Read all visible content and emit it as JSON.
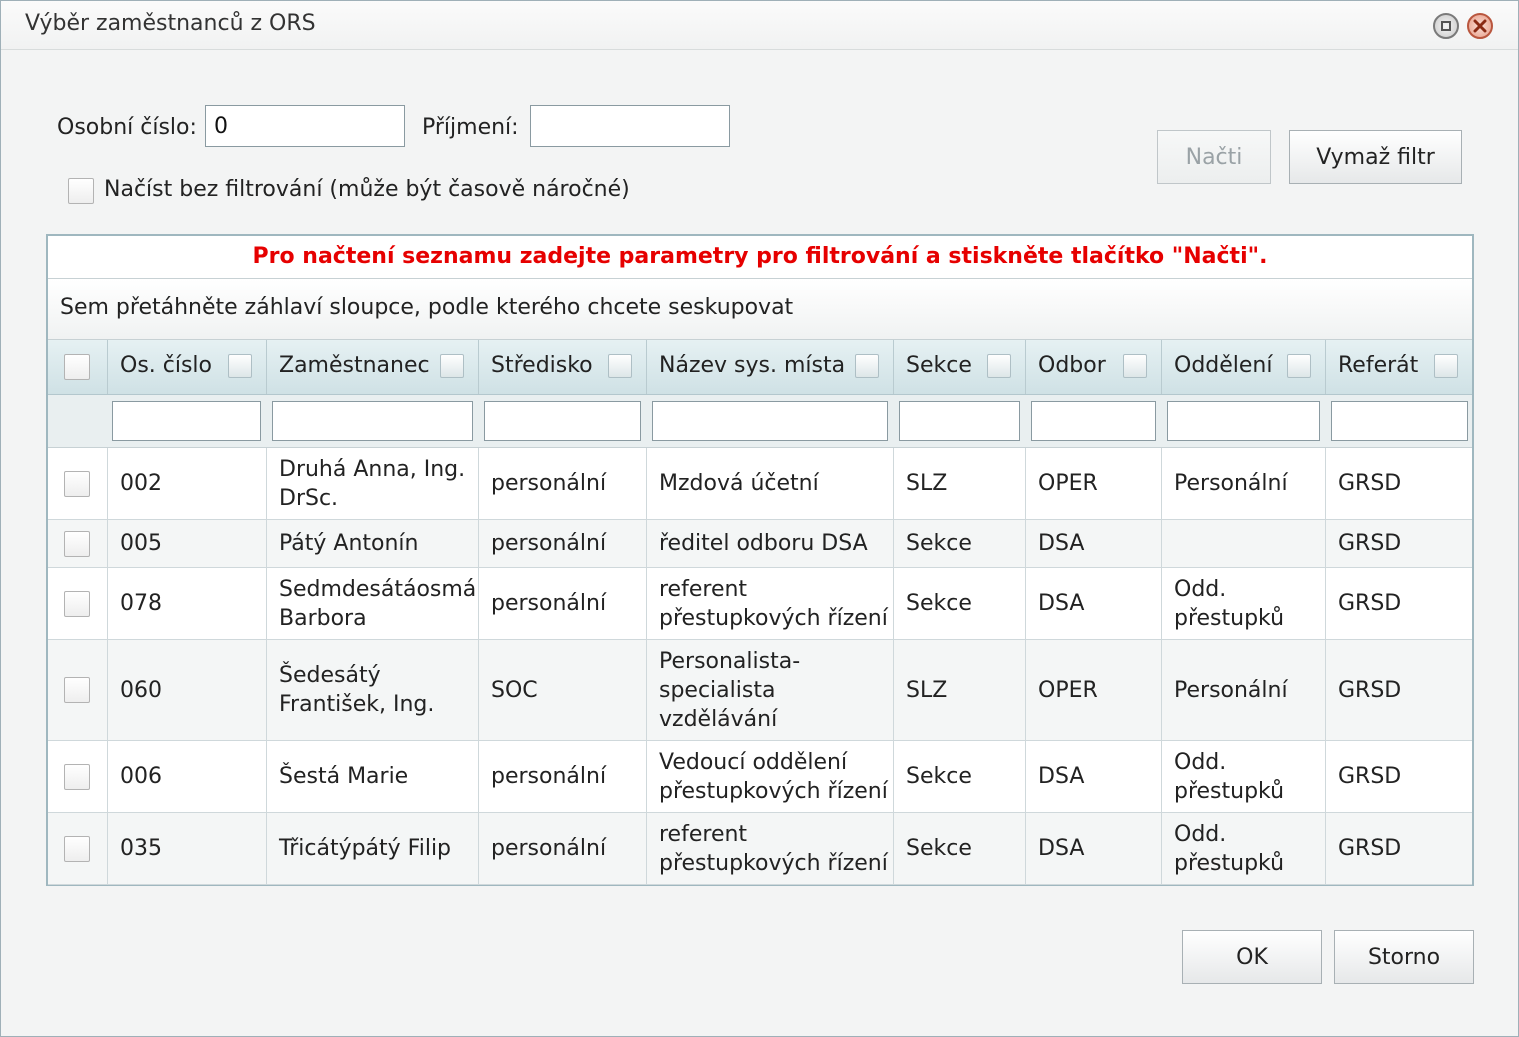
{
  "window": {
    "title": "Výběr zaměstnanců z ORS"
  },
  "filters": {
    "personal_number_label": "Osobní číslo:",
    "personal_number_value": "0",
    "surname_label": "Příjmení:",
    "surname_value": "",
    "no_filter_label": "Načíst bez filtrování (může být časově náročné)",
    "load_button": "Načti",
    "clear_button": "Vymaž filtr"
  },
  "grid": {
    "message": "Pro načtení seznamu zadejte parametry pro filtrování a stiskněte tlačítko \"Načti\".",
    "group_hint": "Sem přetáhněte záhlaví sloupce, podle kterého chcete seskupovat",
    "columns": [
      "Os. číslo",
      "Zaměstnanec",
      "Středisko",
      "Název sys. místa",
      "Sekce",
      "Odbor",
      "Oddělení",
      "Referát"
    ],
    "rows": [
      {
        "os": "002",
        "zam": "Druhá Anna, Ing. DrSc.",
        "str": "personální",
        "nazev": "Mzdová účetní",
        "sekce": "SLZ",
        "odbor": "OPER",
        "odd": "Personální",
        "ref": "GRSD"
      },
      {
        "os": "005",
        "zam": "Pátý Antonín",
        "str": "personální",
        "nazev": "ředitel odboru DSA",
        "sekce": "Sekce",
        "odbor": "DSA",
        "odd": "",
        "ref": "GRSD"
      },
      {
        "os": "078",
        "zam": "Sedmdesátáosmá Barbora",
        "str": "personální",
        "nazev": "referent přestupkových řízení",
        "sekce": "Sekce",
        "odbor": "DSA",
        "odd": "Odd. přestupků",
        "ref": "GRSD"
      },
      {
        "os": "060",
        "zam": "Šedesátý František, Ing.",
        "str": "SOC",
        "nazev": "Personalista-specialista vzdělávání",
        "sekce": "SLZ",
        "odbor": "OPER",
        "odd": "Personální",
        "ref": "GRSD"
      },
      {
        "os": "006",
        "zam": "Šestá Marie",
        "str": "personální",
        "nazev": "Vedoucí oddělení přestupkových řízení",
        "sekce": "Sekce",
        "odbor": "DSA",
        "odd": "Odd. přestupků",
        "ref": "GRSD"
      },
      {
        "os": "035",
        "zam": "Třicátýpátý Filip",
        "str": "personální",
        "nazev": "referent přestupkových řízení",
        "sekce": "Sekce",
        "odbor": "DSA",
        "odd": "Odd. přestupků",
        "ref": "GRSD"
      }
    ]
  },
  "footer": {
    "ok_button": "OK",
    "cancel_button": "Storno"
  }
}
